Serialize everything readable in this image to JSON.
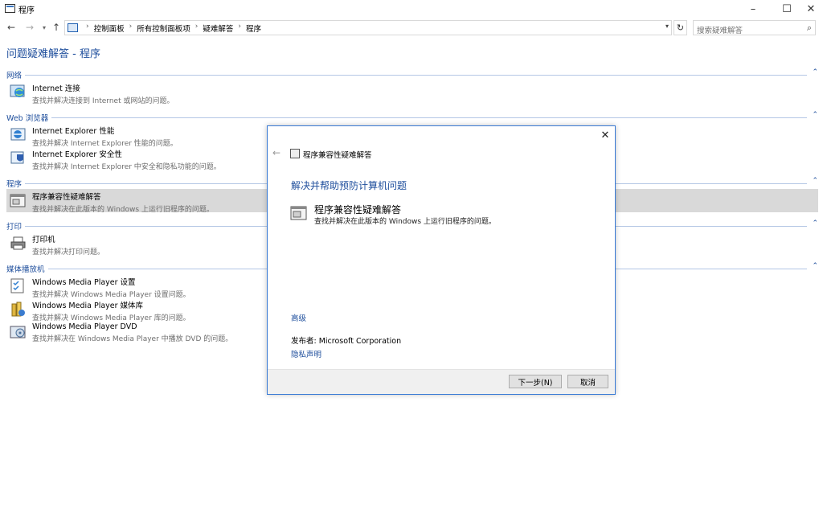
{
  "window": {
    "title": "程序"
  },
  "address": {
    "crumbs": [
      "控制面板",
      "所有控制面板项",
      "疑难解答",
      "程序"
    ],
    "search_placeholder": "搜索疑难解答"
  },
  "page_title": "问题疑难解答 - 程序",
  "groups": [
    {
      "label": "网络",
      "items": [
        {
          "title": "Internet 连接",
          "desc": "查找并解决连接到 Internet 或网站的问题。"
        }
      ]
    },
    {
      "label": "Web 浏览器",
      "items": [
        {
          "title": "Internet Explorer 性能",
          "desc": "查找并解决 Internet Explorer 性能的问题。"
        },
        {
          "title": "Internet Explorer 安全性",
          "desc": "查找并解决 Internet Explorer 中安全和隐私功能的问题。"
        }
      ]
    },
    {
      "label": "程序",
      "items": [
        {
          "title": "程序兼容性疑难解答",
          "desc": "查找并解决在此版本的 Windows 上运行旧程序的问题。"
        }
      ]
    },
    {
      "label": "打印",
      "items": [
        {
          "title": "打印机",
          "desc": "查找并解决打印问题。"
        }
      ]
    },
    {
      "label": "媒体播放机",
      "items": [
        {
          "title": "Windows Media Player 设置",
          "desc": "查找并解决 Windows Media Player 设置问题。"
        },
        {
          "title": "Windows Media Player 媒体库",
          "desc": "查找并解决 Windows Media Player 库的问题。"
        },
        {
          "title": "Windows Media Player DVD",
          "desc": "查找并解决在 Windows Media Player 中播放 DVD 的问题。"
        }
      ]
    }
  ],
  "dialog": {
    "header_title": "程序兼容性疑难解答",
    "heading": "解决并帮助预防计算机问题",
    "option_title": "程序兼容性疑难解答",
    "option_desc": "查找并解决在此版本的 Windows 上运行旧程序的问题。",
    "advanced": "高级",
    "publisher": "发布者: Microsoft Corporation",
    "privacy": "隐私声明",
    "next_label": "下一步(N)",
    "cancel_label": "取消"
  },
  "colors": {
    "link": "#1e4e9c",
    "dialog_border": "#3a7bd5",
    "selected_row": "#d9d9d9"
  }
}
